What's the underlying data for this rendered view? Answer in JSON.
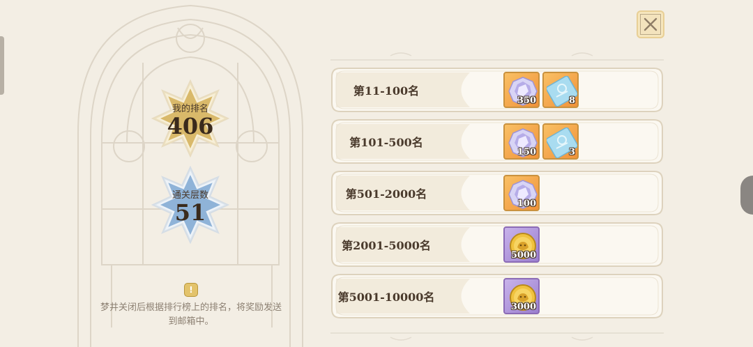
{
  "summary": {
    "my_rank_label": "我的排名",
    "my_rank_value": "406",
    "floors_label": "通关层数",
    "floors_value": "51"
  },
  "notice": {
    "icon": "exclamation-icon",
    "text": "梦井关闭后根据排行榜上的排名，将奖励发送到邮箱中。"
  },
  "close": {
    "icon": "close-x-icon"
  },
  "rewards_table": [
    {
      "rank": "第11-100名",
      "items": [
        {
          "icon": "crystal-gem-icon",
          "count": "350"
        },
        {
          "icon": "blue-ticket-icon",
          "count": "8"
        }
      ]
    },
    {
      "rank": "第101-500名",
      "items": [
        {
          "icon": "crystal-gem-icon",
          "count": "150"
        },
        {
          "icon": "blue-ticket-icon",
          "count": "3"
        }
      ]
    },
    {
      "rank": "第501-2000名",
      "items": [
        {
          "icon": "crystal-gem-icon",
          "count": "100"
        }
      ]
    },
    {
      "rank": "第2001-5000名",
      "items": [
        {
          "icon": "gold-coin-icon",
          "count": "5000"
        }
      ]
    },
    {
      "rank": "第5001-10000名",
      "items": [
        {
          "icon": "gold-coin-icon",
          "count": "3000"
        }
      ]
    }
  ],
  "colors": {
    "background": "#f3eee4",
    "gold_badge": "#d9b96a",
    "blue_badge": "#8fb3d8",
    "orange_reward": "#f0923a",
    "purple_reward": "#9b7fcf"
  }
}
